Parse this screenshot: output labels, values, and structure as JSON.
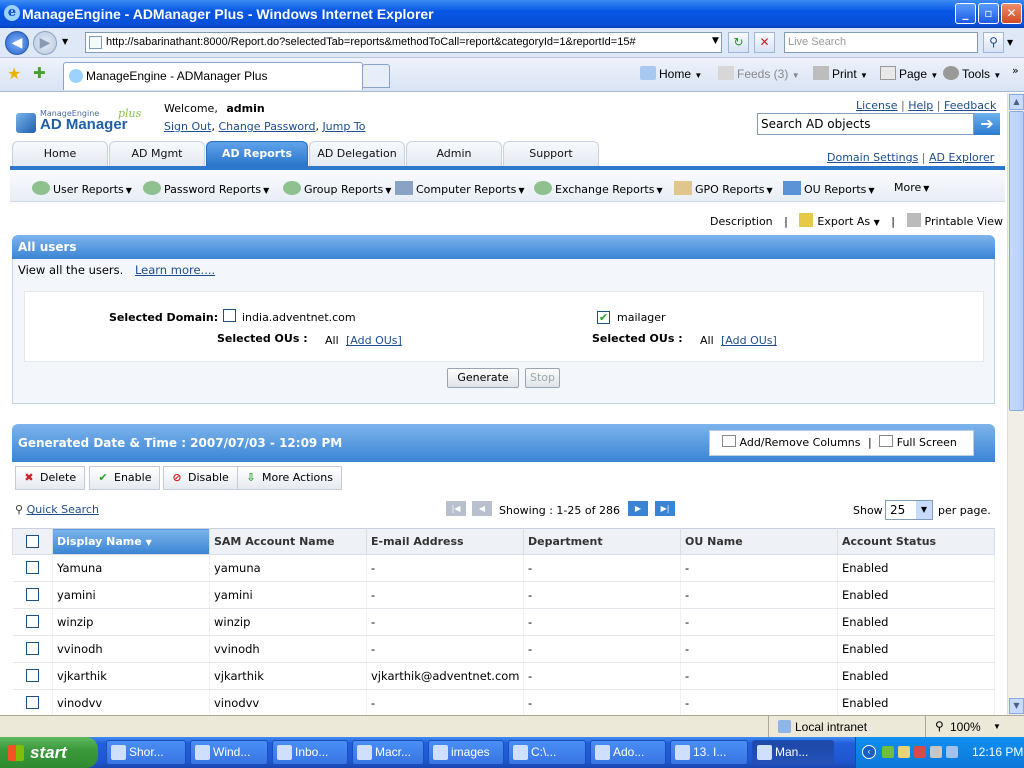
{
  "window": {
    "title": "ManageEngine - ADManager Plus - Windows Internet Explorer"
  },
  "browser": {
    "url": "http://sabarinathant:8000/Report.do?selectedTab=reports&methodToCall=report&categoryId=1&reportId=15#",
    "search_placeholder": "Live Search",
    "tab_title": "ManageEngine - ADManager Plus",
    "home": "Home",
    "feeds": "Feeds (3)",
    "print": "Print",
    "page": "Page",
    "tools": "Tools"
  },
  "app": {
    "logo_top": "ManageEngine",
    "logo_main": "AD Manager",
    "logo_plus": "plus",
    "welcome": "Welcome,",
    "user": "admin",
    "sign_out": "Sign Out",
    "change_password": "Change Password",
    "jump_to": "Jump To",
    "top_links": [
      "License",
      "Help",
      "Feedback"
    ],
    "search_value": "Search AD objects",
    "right_links": [
      "Domain Settings",
      "AD Explorer"
    ],
    "tabs": [
      "Home",
      "AD Mgmt",
      "AD Reports",
      "AD Delegation",
      "Admin",
      "Support"
    ],
    "subnav": [
      "User Reports",
      "Password Reports",
      "Group Reports",
      "Computer Reports",
      "Exchange Reports",
      "GPO Reports",
      "OU Reports",
      "More"
    ]
  },
  "report": {
    "description": "Description",
    "export_as": "Export As",
    "printable_view": "Printable View",
    "title": "All users",
    "desc_text": "View all the users.",
    "learn_more": "Learn more....",
    "selected_domain_label": "Selected Domain:",
    "domain1": "india.adventnet.com",
    "domain2": "mailager",
    "selected_ous_label": "Selected OUs :",
    "ous_value": "All",
    "add_ous": "[Add OUs]",
    "generate": "Generate",
    "stop": "Stop"
  },
  "results": {
    "generated": "Generated Date & Time : 2007/07/03 - 12:09 PM",
    "add_remove_columns": "Add/Remove Columns",
    "full_screen": "Full Screen",
    "actions": [
      "Delete",
      "Enable",
      "Disable",
      "More Actions"
    ],
    "quick_search": "Quick Search",
    "showing": "Showing : 1-25 of 286",
    "show_label": "Show",
    "per_page_value": "25",
    "per_page_label": "per page.",
    "columns": [
      "Display Name",
      "SAM Account Name",
      "E-mail Address",
      "Department",
      "OU Name",
      "Account Status"
    ],
    "rows": [
      [
        "Yamuna",
        "yamuna",
        "-",
        "-",
        "-",
        "Enabled"
      ],
      [
        "yamini",
        "yamini",
        "-",
        "-",
        "-",
        "Enabled"
      ],
      [
        "winzip",
        "winzip",
        "-",
        "-",
        "-",
        "Enabled"
      ],
      [
        "vvinodh",
        "vvinodh",
        "-",
        "-",
        "-",
        "Enabled"
      ],
      [
        "vjkarthik",
        "vjkarthik",
        "vjkarthik@adventnet.com",
        "-",
        "-",
        "Enabled"
      ],
      [
        "vinodvv",
        "vinodvv",
        "-",
        "-",
        "-",
        "Enabled"
      ]
    ]
  },
  "status": {
    "zone": "Local intranet",
    "zoom": "100%"
  },
  "taskbar": {
    "start": "start",
    "tasks": [
      "Shor...",
      "Wind...",
      "Inbo...",
      "Macr...",
      "images",
      "C:\\...",
      "Ado...",
      "13. I...",
      "Man..."
    ],
    "clock": "12:16 PM"
  }
}
